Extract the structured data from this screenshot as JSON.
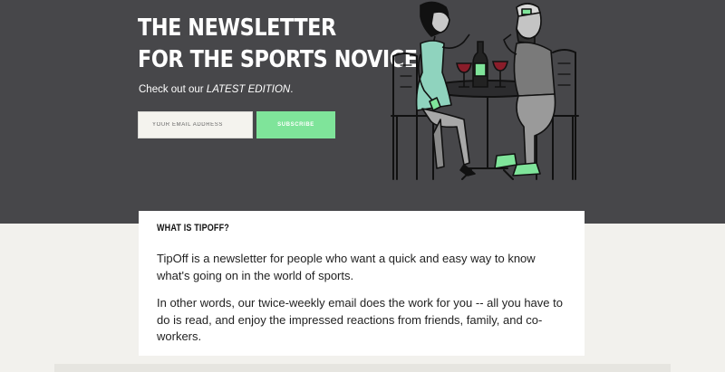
{
  "hero": {
    "headline_line1": "THE NEWSLETTER",
    "headline_line2": "FOR THE SPORTS NOVICE",
    "latest_prefix": "Check out our ",
    "latest_link": "LATEST EDITION",
    "latest_suffix": ".",
    "email_placeholder": "YOUR EMAIL ADDRESS",
    "subscribe_label": "SUBSCRIBE"
  },
  "about": {
    "heading": "WHAT IS TIPOFF?",
    "paragraph1": "TipOff is a newsletter for people who want a quick and easy way to know what's going on in the world of sports.",
    "paragraph2": "In other words, our twice-weekly email does the work for you -- all you have to do is read, and enjoy the impressed reactions from friends, family, and co-workers."
  },
  "colors": {
    "hero_background": "#47474a",
    "page_background": "#f2f1ed",
    "accent_green": "#7fe49a",
    "card_background": "#ffffff"
  }
}
